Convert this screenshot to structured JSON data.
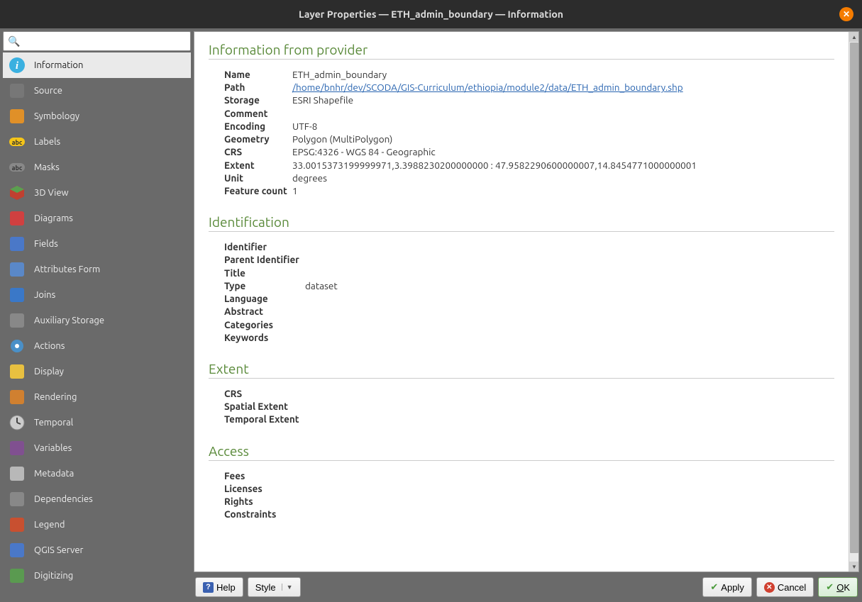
{
  "titlebar": {
    "title": "Layer Properties — ETH_admin_boundary — Information"
  },
  "sidebar": {
    "search_placeholder": "",
    "items": [
      {
        "label": "Information",
        "active": true,
        "icon": "info-icon",
        "bg": "#3ab0e0"
      },
      {
        "label": "Source",
        "active": false,
        "icon": "wrench-icon",
        "bg": "#777"
      },
      {
        "label": "Symbology",
        "active": false,
        "icon": "brush-icon",
        "bg": "#e09028"
      },
      {
        "label": "Labels",
        "active": false,
        "icon": "labels-icon",
        "bg": "#f5c518"
      },
      {
        "label": "Masks",
        "active": false,
        "icon": "masks-icon",
        "bg": "#888"
      },
      {
        "label": "3D View",
        "active": false,
        "icon": "cube-icon",
        "bg": "#c04030"
      },
      {
        "label": "Diagrams",
        "active": false,
        "icon": "diagram-icon",
        "bg": "#d04040"
      },
      {
        "label": "Fields",
        "active": false,
        "icon": "fields-icon",
        "bg": "#4a78c8"
      },
      {
        "label": "Attributes Form",
        "active": false,
        "icon": "form-icon",
        "bg": "#5a88c8"
      },
      {
        "label": "Joins",
        "active": false,
        "icon": "joins-icon",
        "bg": "#3a78c8"
      },
      {
        "label": "Auxiliary Storage",
        "active": false,
        "icon": "storage-icon",
        "bg": "#888"
      },
      {
        "label": "Actions",
        "active": false,
        "icon": "gear-icon",
        "bg": "#4a90c8"
      },
      {
        "label": "Display",
        "active": false,
        "icon": "display-icon",
        "bg": "#e8c040"
      },
      {
        "label": "Rendering",
        "active": false,
        "icon": "render-icon",
        "bg": "#d08030"
      },
      {
        "label": "Temporal",
        "active": false,
        "icon": "clock-icon",
        "bg": "#ccc"
      },
      {
        "label": "Variables",
        "active": false,
        "icon": "var-icon",
        "bg": "#805090"
      },
      {
        "label": "Metadata",
        "active": false,
        "icon": "metadata-icon",
        "bg": "#b8b8b8"
      },
      {
        "label": "Dependencies",
        "active": false,
        "icon": "deps-icon",
        "bg": "#888"
      },
      {
        "label": "Legend",
        "active": false,
        "icon": "legend-icon",
        "bg": "#c85030"
      },
      {
        "label": "QGIS Server",
        "active": false,
        "icon": "server-icon",
        "bg": "#4a78c8"
      },
      {
        "label": "Digitizing",
        "active": false,
        "icon": "digitize-icon",
        "bg": "#5a9a50"
      }
    ]
  },
  "sections": {
    "provider": {
      "heading": "Information from provider",
      "rows": [
        {
          "k": "Name",
          "v": "ETH_admin_boundary"
        },
        {
          "k": "Path",
          "v": "/home/bnhr/dev/SCODA/GIS-Curriculum/ethiopia/module2/data/ETH_admin_boundary.shp",
          "link": true
        },
        {
          "k": "Storage",
          "v": "ESRI Shapefile"
        },
        {
          "k": "Comment",
          "v": ""
        },
        {
          "k": "Encoding",
          "v": "UTF-8"
        },
        {
          "k": "Geometry",
          "v": "Polygon (MultiPolygon)"
        },
        {
          "k": "CRS",
          "v": "EPSG:4326 - WGS 84 - Geographic"
        },
        {
          "k": "Extent",
          "v": "33.0015373199999971,3.3988230200000000 : 47.9582290600000007,14.8454771000000001"
        },
        {
          "k": "Unit",
          "v": "degrees"
        },
        {
          "k": "Feature count",
          "v": "1"
        }
      ]
    },
    "identification": {
      "heading": "Identification",
      "rows": [
        {
          "k": "Identifier",
          "v": ""
        },
        {
          "k": "Parent Identifier",
          "v": ""
        },
        {
          "k": "Title",
          "v": ""
        },
        {
          "k": "Type",
          "v": "dataset"
        },
        {
          "k": "Language",
          "v": ""
        },
        {
          "k": "Abstract",
          "v": ""
        },
        {
          "k": "Categories",
          "v": ""
        },
        {
          "k": "Keywords",
          "v": ""
        }
      ]
    },
    "extent": {
      "heading": "Extent",
      "rows": [
        {
          "k": "CRS",
          "v": ""
        },
        {
          "k": "Spatial Extent",
          "v": ""
        },
        {
          "k": "Temporal Extent",
          "v": ""
        }
      ]
    },
    "access": {
      "heading": "Access",
      "rows": [
        {
          "k": "Fees",
          "v": ""
        },
        {
          "k": "Licenses",
          "v": ""
        },
        {
          "k": "Rights",
          "v": ""
        },
        {
          "k": "Constraints",
          "v": ""
        }
      ]
    }
  },
  "buttons": {
    "help": "Help",
    "style": "Style",
    "apply": "Apply",
    "cancel": "Cancel",
    "ok": "OK"
  }
}
